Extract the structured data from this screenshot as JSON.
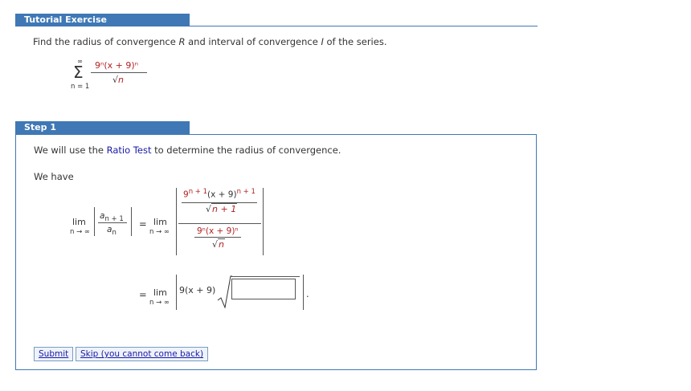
{
  "tutorial": {
    "header": "Tutorial Exercise"
  },
  "problem": {
    "prefix": "Find the radius of convergence ",
    "var_R": "R",
    "mid": " and interval of convergence ",
    "var_I": "I",
    "suffix": " of the series.",
    "sum_sym": "Σ",
    "sum_top": "∞",
    "sum_bottom": "n = 1",
    "num": "9ⁿ(x + 9)ⁿ",
    "den_root": "√",
    "den_var": "n"
  },
  "step1": {
    "header": "Step 1",
    "intro_pre": "We will use the ",
    "ratio_link": "Ratio Test",
    "intro_post": " to determine the radius of convergence.",
    "we_have": "We have",
    "lim": "lim",
    "lim_sub": "n → ∞",
    "a_top": "a",
    "a_top_sub": "n + 1",
    "a_bot": "a",
    "a_bot_sub": "n",
    "eq": "=",
    "big_num_top": "9",
    "big_num_top_exp": "n + 1",
    "big_num_top_rest": "(x + 9)",
    "big_num_top_exp2": "n + 1",
    "big_num_bot_root": "√",
    "big_num_bot_arg": "n + 1",
    "big_den_top": "9ⁿ(x + 9)ⁿ",
    "big_den_bot_root": "√",
    "big_den_bot_arg": "n",
    "line2_expr": "9(x + 9)",
    "line2_root": "√",
    "period": "."
  },
  "buttons": {
    "submit": "Submit",
    "skip": "Skip (you cannot come back)"
  }
}
